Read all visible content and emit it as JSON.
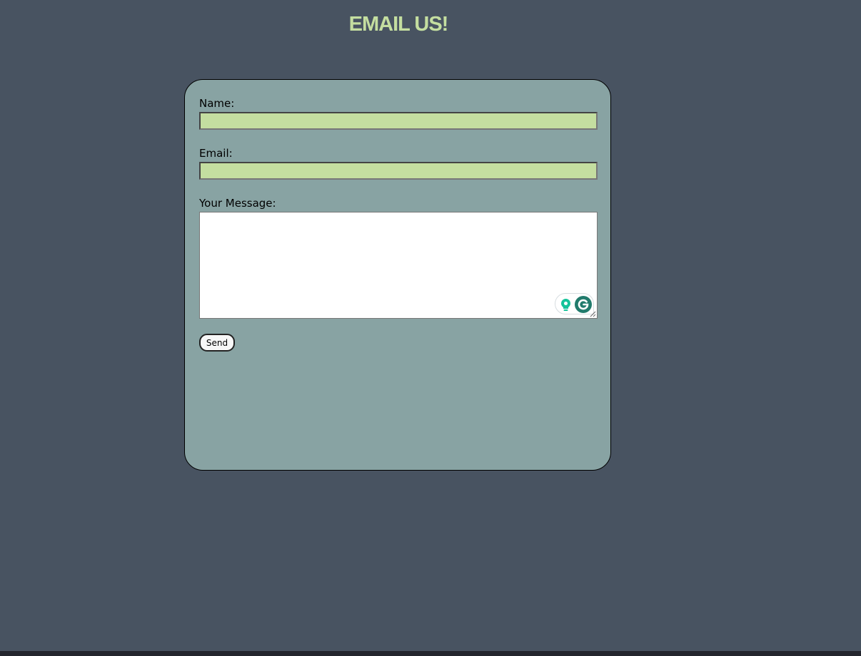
{
  "page": {
    "title": "EMAIL US!"
  },
  "form": {
    "name_label": "Name:",
    "name_value": "",
    "email_label": "Email:",
    "email_value": "",
    "message_label": "Your Message:",
    "message_value": "",
    "send_label": "Send"
  },
  "icons": {
    "suggestion": "lightbulb-icon",
    "grammarly": "grammarly-g-icon",
    "resize": "resize-grip-icon"
  },
  "colors": {
    "background": "#485361",
    "card": "#88a3a3",
    "accent": "#c4dea0",
    "grammarly_green": "#15c39a",
    "grammarly_dark": "#217b6c"
  }
}
